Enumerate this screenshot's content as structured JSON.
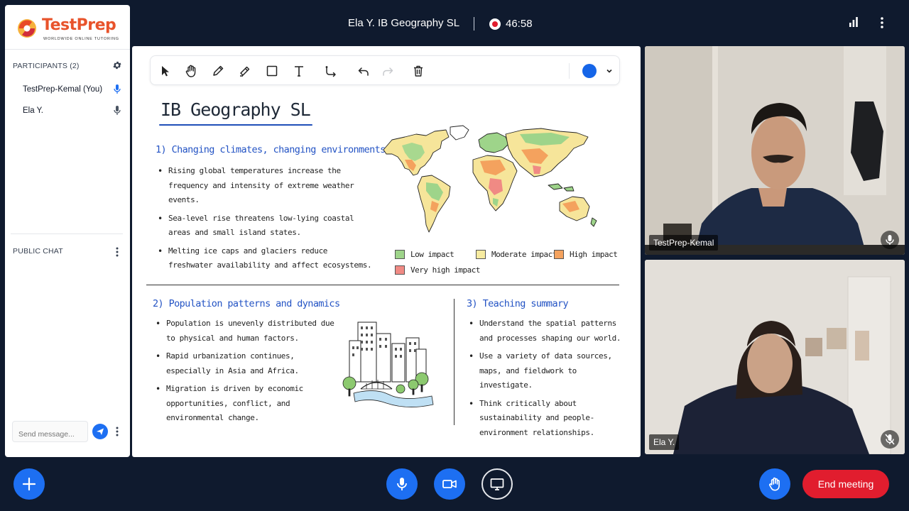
{
  "header": {
    "meeting_title": "Ela Y. IB Geography SL",
    "timer": "46:58",
    "record_color": "#e11d2e"
  },
  "brand": {
    "name": "TestPrep",
    "tagline": "WORLDWIDE ONLINE TUTORING",
    "color": "#e8532b"
  },
  "sidebar": {
    "participants_title": "PARTICIPANTS (2)",
    "participants": [
      {
        "name": "TestPrep-Kemal (You)",
        "mic": "active"
      },
      {
        "name": "Ela Y.",
        "mic": "idle"
      }
    ],
    "chat_title": "PUBLIC CHAT",
    "chat_placeholder": "Send message..."
  },
  "whiteboard": {
    "tools": [
      "select-icon",
      "hand-icon",
      "pencil-icon",
      "highlighter-icon",
      "rectangle-icon",
      "text-icon",
      "connector-icon",
      "undo-icon",
      "redo-icon",
      "trash-icon"
    ],
    "pen_color": "#1565e8",
    "title": "IB Geography SL",
    "section1": {
      "heading": "1) Changing climates, changing environments",
      "bullets": [
        "Rising global temperatures increase the frequency and intensity of extreme weather events.",
        "Sea-level rise threatens low-lying coastal areas and small island states.",
        "Melting ice caps and glaciers reduce freshwater availability and affect ecosystems."
      ]
    },
    "legend": [
      {
        "label": "Low impact",
        "color": "#9ed48a"
      },
      {
        "label": "Moderate impact",
        "color": "#f7eba0"
      },
      {
        "label": "High impact",
        "color": "#f4a25e"
      },
      {
        "label": "Very high impact",
        "color": "#f08a84"
      }
    ],
    "section2": {
      "heading": "2) Population patterns and dynamics",
      "bullets": [
        "Population is unevenly distributed due to physical and human factors.",
        "Rapid urbanization continues, especially in Asia and Africa.",
        "Migration is driven by economic opportunities, conflict, and environmental change."
      ]
    },
    "section3": {
      "heading": "3) Teaching summary",
      "bullets": [
        "Understand the spatial patterns and processes shaping our world.",
        "Use a variety of data sources, maps, and fieldwork to investigate.",
        "Think critically about sustainability and people-environment relationships."
      ]
    }
  },
  "videos": {
    "kemal": {
      "name": "TestPrep-Kemal",
      "mic": "on"
    },
    "ela": {
      "name": "Ela Y.",
      "mic": "muted"
    }
  },
  "controls": {
    "end_label": "End meeting",
    "end_color": "#e11d2e",
    "accent": "#1d6ff2"
  }
}
